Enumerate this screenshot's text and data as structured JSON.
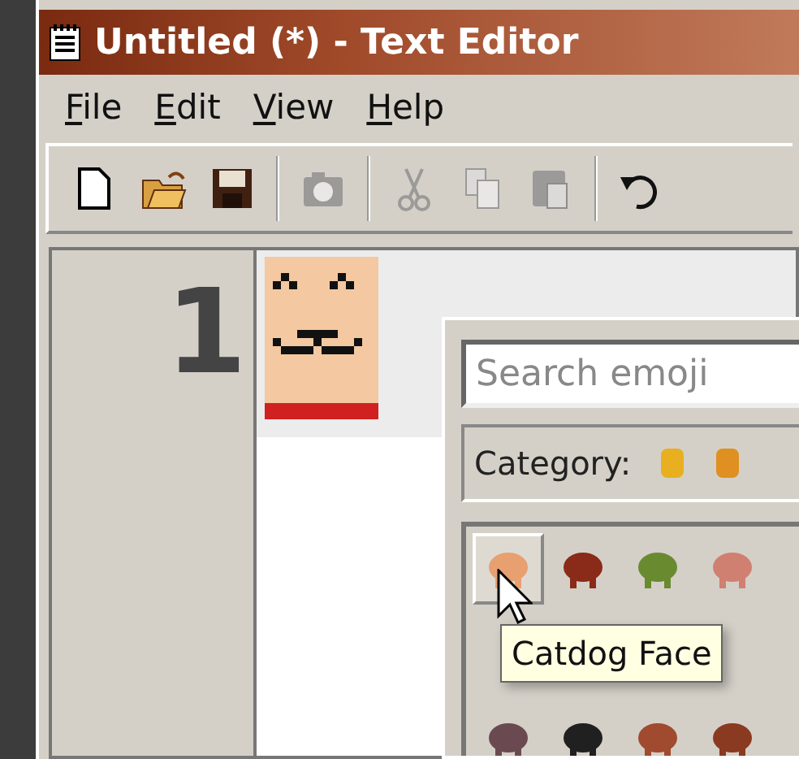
{
  "window": {
    "title": "Untitled (*) - Text Editor"
  },
  "menu": [
    {
      "label": "File"
    },
    {
      "label": "Edit"
    },
    {
      "label": "View"
    },
    {
      "label": "Help"
    }
  ],
  "toolbar": [
    {
      "kind": "new",
      "disabled": false
    },
    {
      "kind": "open",
      "disabled": false
    },
    {
      "kind": "save",
      "disabled": false
    },
    {
      "kind": "separator"
    },
    {
      "kind": "screenshot",
      "disabled": true
    },
    {
      "kind": "separator"
    },
    {
      "kind": "cut",
      "disabled": true
    },
    {
      "kind": "copy",
      "disabled": true
    },
    {
      "kind": "paste",
      "disabled": true
    },
    {
      "kind": "separator"
    },
    {
      "kind": "undo",
      "disabled": false
    }
  ],
  "editor": {
    "line_numbers": [
      "1"
    ]
  },
  "emoji_picker": {
    "search": {
      "placeholder": "Search emoji"
    },
    "category_label": "Category:",
    "categories": [
      {
        "color": "#e8b020"
      },
      {
        "color": "#e09020"
      }
    ],
    "grid": [
      [
        {
          "selected": true,
          "color": "#e8a070"
        },
        {
          "selected": false,
          "color": "#8a2a18"
        },
        {
          "selected": false,
          "color": "#6a8a30"
        },
        {
          "selected": false,
          "color": "#d08070"
        }
      ],
      [
        {
          "selected": false,
          "color": "#6a4a50"
        },
        {
          "selected": false,
          "color": "#202020"
        },
        {
          "selected": false,
          "color": "#a04a30"
        },
        {
          "selected": false,
          "color": "#8a3a20"
        }
      ]
    ],
    "tooltip": "Catdog Face"
  }
}
